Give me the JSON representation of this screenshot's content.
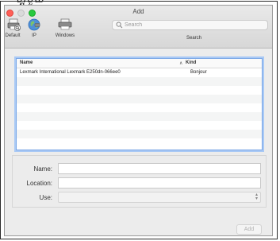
{
  "annotation": {
    "corner_text": "ហ្គមួយ"
  },
  "window": {
    "title": "Add"
  },
  "toolbar": {
    "tools": [
      {
        "label": "Default",
        "icon": "printer-default-icon"
      },
      {
        "label": "IP",
        "icon": "globe-icon"
      },
      {
        "label": "Windows",
        "icon": "windows-printer-icon"
      }
    ],
    "search": {
      "placeholder": "Search",
      "label": "Search",
      "icon": "search-icon"
    }
  },
  "table": {
    "columns": [
      {
        "label": "Name"
      },
      {
        "label": "Kind",
        "sort": "ascending"
      }
    ],
    "rows": [
      {
        "name": "Lexmark International Lexmark E250dn-066ee0",
        "kind": "Bonjour"
      }
    ]
  },
  "form": {
    "name": {
      "label": "Name:",
      "value": ""
    },
    "location": {
      "label": "Location:",
      "value": ""
    },
    "use": {
      "label": "Use:",
      "value": ""
    }
  },
  "buttons": {
    "add": "Add"
  },
  "colors": {
    "close": "#ff5f57",
    "minimize": "#dadada",
    "maximize": "#28c940",
    "table_focus": "#7aa7e6"
  }
}
